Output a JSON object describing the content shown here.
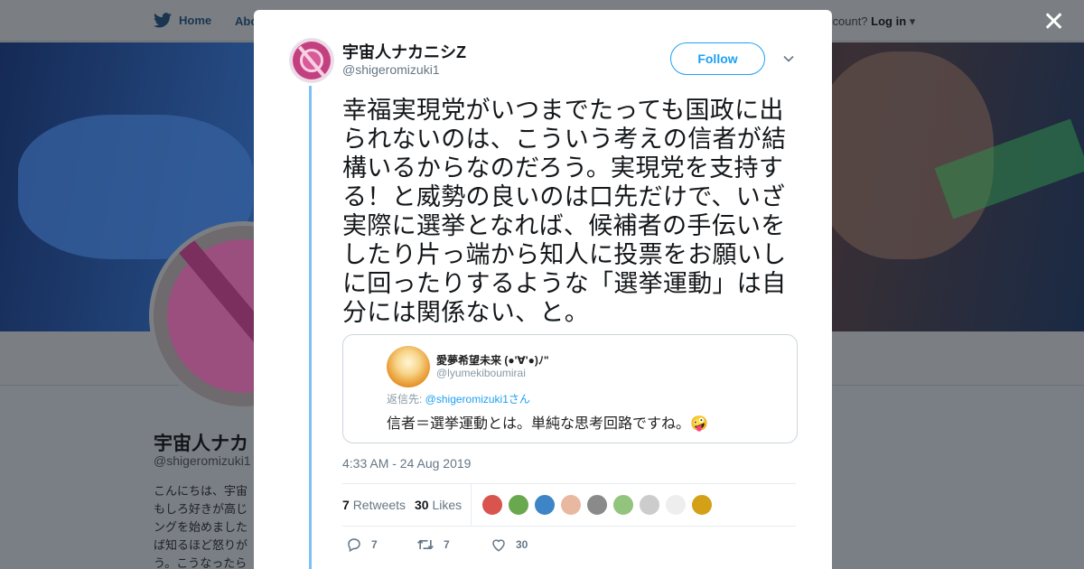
{
  "background": {
    "nav": {
      "home_label": "Home",
      "about_label": "Abo",
      "login_prefix": "ccount?",
      "login_label": "Log in"
    },
    "profile": {
      "name": "宇宙人ナカ",
      "handle": "@shigeromizuki1",
      "bio": "こんにちは、宇宙 もしろ好きが高じ ングを始めました ば知るほど怒りが う。こうなったら"
    }
  },
  "modal": {
    "close_label": "✕",
    "author": {
      "name": "宇宙人ナカニシZ",
      "handle": "@shigeromizuki1"
    },
    "follow_label": "Follow",
    "tweet_text": "幸福実現党がいつまでたっても国政に出られないのは、こういう考えの信者が結構いるからなのだろう。実現党を支持する！と威勢の良いのは口先だけで、いざ実際に選挙となれば、候補者の手伝いをしたり片っ端から知人に投票をお願いしに回ったりするような「選挙運動」は自分には関係ない、と。",
    "quoted": {
      "name": "愛夢希望未来 (●'∀'●)ﾉ\"",
      "handle": "@lyumekiboumirai",
      "reply_prefix": "返信先: ",
      "reply_to": "@shigeromizuki1さん",
      "text": "信者＝選挙運動とは。単純な思考回路ですね。🤪"
    },
    "timestamp": "4:33 AM - 24 Aug 2019",
    "stats": {
      "retweets_count": "7",
      "retweets_label": "Retweets",
      "likes_count": "30",
      "likes_label": "Likes"
    },
    "liker_avatar_colors": [
      "#d9534f",
      "#6aa84f",
      "#3d85c6",
      "#e8b9a0",
      "#8a8a8a",
      "#93c47d",
      "#cccccc",
      "#eeeeee",
      "#d4a017"
    ],
    "actions": {
      "reply_count": "7",
      "retweet_count": "7",
      "like_count": "30"
    }
  },
  "colors": {
    "accent": "#1da1f2",
    "thread_line": "#7cc0f5"
  }
}
